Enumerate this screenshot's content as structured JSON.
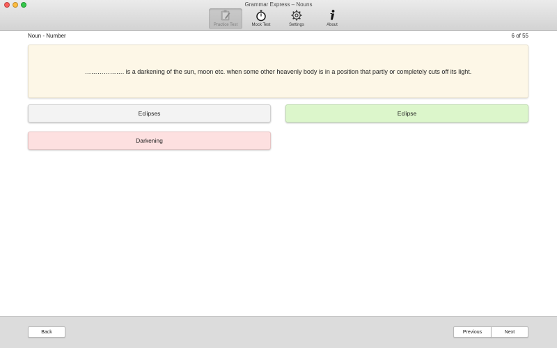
{
  "window": {
    "title": "Grammar Express – Nouns"
  },
  "toolbar": {
    "items": [
      {
        "label": "Practice Test",
        "icon": "clipboard-icon",
        "active": true
      },
      {
        "label": "Mock Test",
        "icon": "stopwatch-icon",
        "active": false
      },
      {
        "label": "Settings",
        "icon": "gear-icon",
        "active": false
      },
      {
        "label": "About",
        "icon": "info-icon",
        "active": false
      }
    ]
  },
  "header": {
    "category": "Noun - Number",
    "progress": "6 of 55"
  },
  "question": {
    "text": "………………. is a darkening of the sun, moon etc. when some other heavenly body is in a position that partly or completely cuts off its light."
  },
  "answers": [
    {
      "label": "Eclipses",
      "state": "neutral"
    },
    {
      "label": "Eclipse",
      "state": "correct"
    },
    {
      "label": "Darkening",
      "state": "wrong"
    }
  ],
  "footer": {
    "back_label": "Back",
    "previous_label": "Previous",
    "next_label": "Next"
  },
  "colors": {
    "correct": "#dcf6cb",
    "wrong": "#fde0e0",
    "question_bg": "#fdf7e7",
    "neutral": "#f3f3f3"
  }
}
